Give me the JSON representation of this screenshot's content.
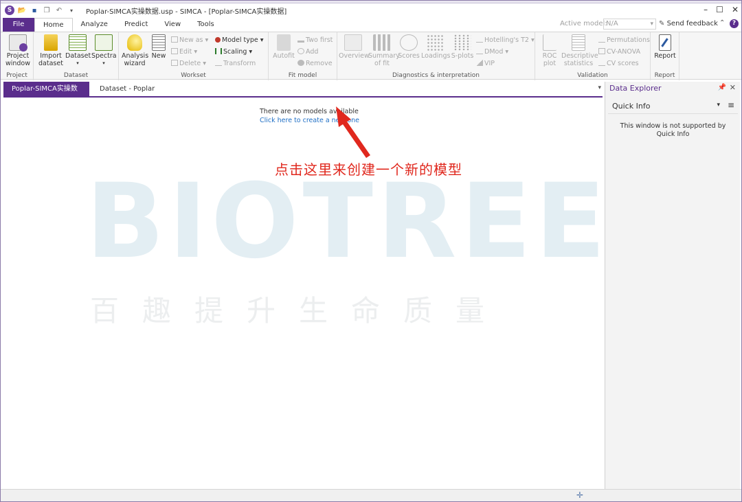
{
  "window": {
    "title": "Poplar-SIMCA实操数据.usp - SIMCA - [Poplar-SIMCA实操数据]",
    "app_logo": "S",
    "controls": {
      "minimize": "–",
      "maximize": "☐",
      "close": "✕"
    }
  },
  "ribbon_tabs": [
    "File",
    "Home",
    "Analyze",
    "Predict",
    "View",
    "Tools"
  ],
  "active_model": {
    "label": "Active model:",
    "value": "N/A"
  },
  "send_feedback": "Send feedback",
  "help": "?",
  "ribbon": {
    "project": {
      "label": "Project",
      "buttons": [
        {
          "label": "Project\nwindow"
        }
      ]
    },
    "dataset": {
      "label": "Dataset",
      "buttons": [
        {
          "label": "Import\ndataset"
        },
        {
          "label": "Dataset"
        },
        {
          "label": "Spectra"
        }
      ]
    },
    "workset": {
      "label": "Workset",
      "big_buttons": [
        {
          "label": "Analysis\nwizard"
        },
        {
          "label": "New"
        }
      ],
      "small_buttons": [
        "New as",
        "Edit",
        "Delete",
        "Model type",
        "Scaling",
        "Transform"
      ]
    },
    "fit_model": {
      "label": "Fit model",
      "big_buttons": [
        {
          "label": "Autofit"
        }
      ],
      "small_buttons": [
        "Two first",
        "Add",
        "Remove"
      ]
    },
    "diagnostics": {
      "label": "Diagnostics & interpretation",
      "big_buttons": [
        "Overview",
        "Summary\nof fit",
        "Scores",
        "Loadings",
        "S-plots"
      ],
      "small_buttons": [
        "Hotelling's T2",
        "DMod",
        "VIP"
      ]
    },
    "validation": {
      "label": "Validation",
      "big_buttons": [
        "ROC\nplot",
        "Descriptive\nstatistics"
      ],
      "small_buttons": [
        "Permutations",
        "CV-ANOVA",
        "CV scores"
      ]
    },
    "report": {
      "label": "Report",
      "big_buttons": [
        "Report"
      ]
    }
  },
  "doc_tabs": [
    "Poplar-SIMCA实操数据",
    "Dataset - Poplar"
  ],
  "main": {
    "no_models_text": "There are no models available",
    "create_link": "Click here to create a new one",
    "annotation": "点击这里来创建一个新的模型"
  },
  "watermark": {
    "word": "BIOTREE",
    "tagline": "百趣提升生命质量"
  },
  "right_pane": {
    "title": "Data Explorer",
    "pin": "🖈",
    "close": "✕",
    "quick_info": "Quick Info",
    "message": "This window is not supported by Quick Info"
  },
  "colors": {
    "accent": "#5a2d8c",
    "link": "#1f6fc5",
    "annotation": "#e0281e",
    "watermark": "#e3eef3"
  }
}
